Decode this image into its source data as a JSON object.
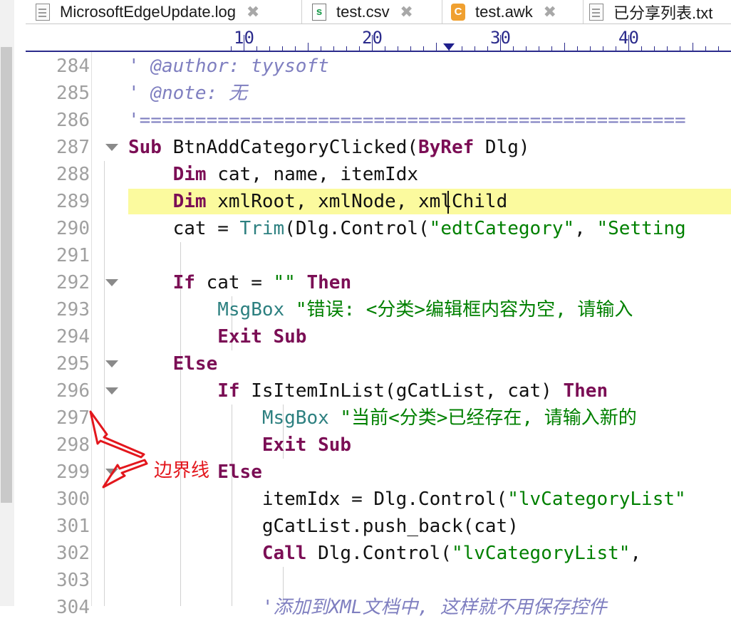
{
  "tabs": [
    {
      "name": "MicrosoftEdgeUpdate.log",
      "icon": "document-icon",
      "close": "✖"
    },
    {
      "name": "test.csv",
      "icon": "csv-file-icon",
      "icon_letter": "s",
      "close": "✖"
    },
    {
      "name": "test.awk",
      "icon": "awk-file-icon",
      "icon_letter": "C",
      "close": "✖"
    },
    {
      "name": "已分享列表.txt",
      "icon": "document-icon"
    }
  ],
  "ruler": {
    "labels": [
      "10",
      "20",
      "30",
      "40"
    ]
  },
  "editor": {
    "highlight_line": "289",
    "lines": [
      {
        "n": "284",
        "fold": false,
        "tokens": [
          [
            "c",
            "' @author: tyysoft"
          ]
        ]
      },
      {
        "n": "285",
        "fold": false,
        "tokens": [
          [
            "c",
            "' @note: 无"
          ]
        ]
      },
      {
        "n": "286",
        "fold": false,
        "tokens": [
          [
            "sep",
            "'================================================="
          ]
        ]
      },
      {
        "n": "287",
        "fold": true,
        "tokens": [
          [
            "k",
            "Sub"
          ],
          [
            "t",
            " BtnAddCategoryClicked("
          ],
          [
            "k",
            "ByRef"
          ],
          [
            "t",
            " Dlg)"
          ]
        ]
      },
      {
        "n": "288",
        "fold": false,
        "tokens": [
          [
            "t",
            "    "
          ],
          [
            "k",
            "Dim"
          ],
          [
            "t",
            " cat, name, itemIdx"
          ]
        ]
      },
      {
        "n": "289",
        "fold": false,
        "tokens": [
          [
            "t",
            "    "
          ],
          [
            "k",
            "Dim"
          ],
          [
            "t",
            " xmlRoot, xmlNode, xmlChild"
          ]
        ]
      },
      {
        "n": "290",
        "fold": false,
        "tokens": [
          [
            "t",
            "    cat = "
          ],
          [
            "f",
            "Trim"
          ],
          [
            "t",
            "(Dlg.Control("
          ],
          [
            "s",
            "\"edtCategory\""
          ],
          [
            "t",
            ", "
          ],
          [
            "s",
            "\"Setting"
          ]
        ]
      },
      {
        "n": "291",
        "fold": false,
        "tokens": []
      },
      {
        "n": "292",
        "fold": true,
        "tokens": [
          [
            "t",
            "    "
          ],
          [
            "k",
            "If"
          ],
          [
            "t",
            " cat = "
          ],
          [
            "s",
            "\"\""
          ],
          [
            "t",
            " "
          ],
          [
            "k",
            "Then"
          ]
        ]
      },
      {
        "n": "293",
        "fold": false,
        "tokens": [
          [
            "t",
            "        "
          ],
          [
            "f",
            "MsgBox"
          ],
          [
            "t",
            " "
          ],
          [
            "s",
            "\"错误: <分类>编辑框内容为空, 请输入"
          ]
        ]
      },
      {
        "n": "294",
        "fold": false,
        "tokens": [
          [
            "t",
            "        "
          ],
          [
            "k",
            "Exit Sub"
          ]
        ]
      },
      {
        "n": "295",
        "fold": true,
        "tokens": [
          [
            "t",
            "    "
          ],
          [
            "k",
            "Else"
          ]
        ]
      },
      {
        "n": "296",
        "fold": true,
        "tokens": [
          [
            "t",
            "        "
          ],
          [
            "k",
            "If"
          ],
          [
            "t",
            " IsItemInList(gCatList, cat) "
          ],
          [
            "k",
            "Then"
          ]
        ]
      },
      {
        "n": "297",
        "fold": false,
        "tokens": [
          [
            "t",
            "            "
          ],
          [
            "f",
            "MsgBox"
          ],
          [
            "t",
            " "
          ],
          [
            "s",
            "\"当前<分类>已经存在, 请输入新的"
          ]
        ]
      },
      {
        "n": "298",
        "fold": false,
        "tokens": [
          [
            "t",
            "            "
          ],
          [
            "k",
            "Exit Sub"
          ]
        ]
      },
      {
        "n": "299",
        "fold": true,
        "tokens": [
          [
            "t",
            "        "
          ],
          [
            "k",
            "Else"
          ]
        ]
      },
      {
        "n": "300",
        "fold": false,
        "tokens": [
          [
            "t",
            "            itemIdx = Dlg.Control("
          ],
          [
            "s",
            "\"lvCategoryList\""
          ]
        ]
      },
      {
        "n": "301",
        "fold": false,
        "tokens": [
          [
            "t",
            "            gCatList.push_back(cat)"
          ]
        ]
      },
      {
        "n": "302",
        "fold": false,
        "tokens": [
          [
            "t",
            "            "
          ],
          [
            "k",
            "Call"
          ],
          [
            "t",
            " Dlg.Control("
          ],
          [
            "s",
            "\"lvCategoryList\""
          ],
          [
            "t",
            ", "
          ]
        ]
      },
      {
        "n": "303",
        "fold": false,
        "tokens": []
      },
      {
        "n": "304",
        "fold": false,
        "tokens": [
          [
            "t",
            "            "
          ],
          [
            "c",
            "'添加到XML文档中, 这样就不用保存控件"
          ]
        ]
      }
    ]
  },
  "annotation": {
    "text": "边界线",
    "color": "#e3171d"
  },
  "colors": {
    "keyword": "#7b0e55",
    "string": "#008000",
    "function": "#2d8080",
    "comment": "#7f7fc0",
    "highlight": "#fbfa9e",
    "ruler": "#2b2b8c"
  }
}
